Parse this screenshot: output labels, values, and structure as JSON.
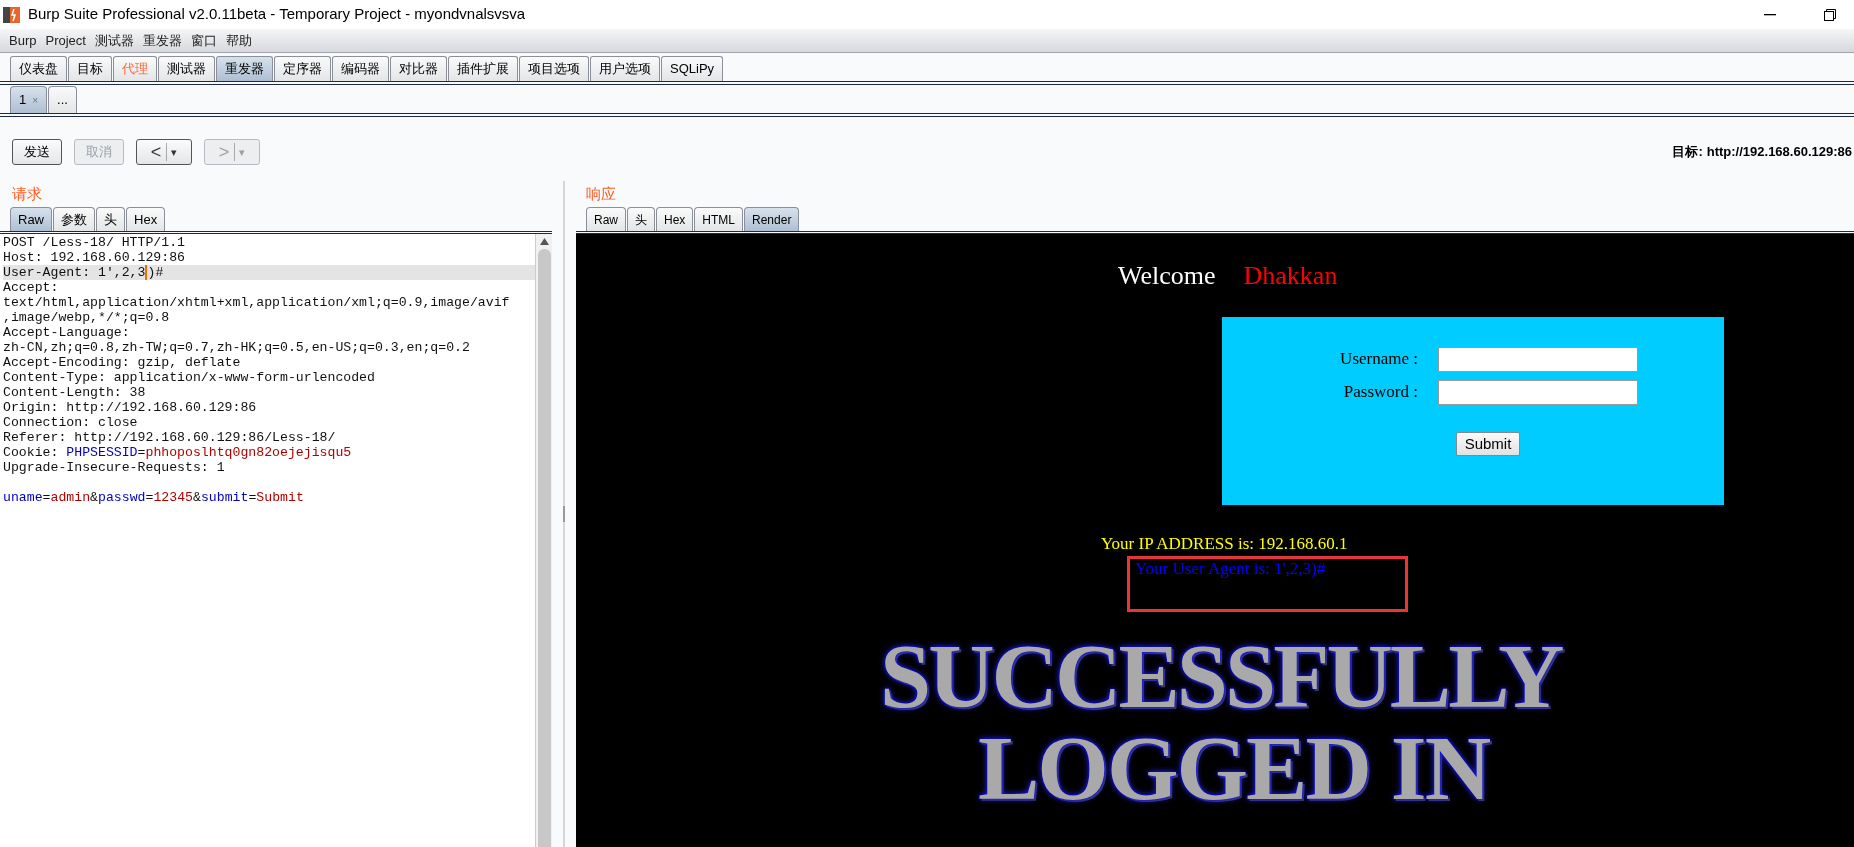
{
  "window": {
    "title": "Burp Suite Professional v2.0.11beta - Temporary Project - myondvnalsvsva"
  },
  "menu": [
    "Burp",
    "Project",
    "测试器",
    "重发器",
    "窗口",
    "帮助"
  ],
  "main_tabs": [
    {
      "label": "仪表盘",
      "selected": false,
      "highlighted": false
    },
    {
      "label": "目标",
      "selected": false,
      "highlighted": false
    },
    {
      "label": "代理",
      "selected": false,
      "highlighted": true
    },
    {
      "label": "测试器",
      "selected": false,
      "highlighted": false
    },
    {
      "label": "重发器",
      "selected": true,
      "highlighted": false
    },
    {
      "label": "定序器",
      "selected": false,
      "highlighted": false
    },
    {
      "label": "编码器",
      "selected": false,
      "highlighted": false
    },
    {
      "label": "对比器",
      "selected": false,
      "highlighted": false
    },
    {
      "label": "插件扩展",
      "selected": false,
      "highlighted": false
    },
    {
      "label": "项目选项",
      "selected": false,
      "highlighted": false
    },
    {
      "label": "用户选项",
      "selected": false,
      "highlighted": false
    },
    {
      "label": "SQLiPy",
      "selected": false,
      "highlighted": false
    }
  ],
  "repeater_tabs": [
    {
      "label": "1",
      "close": "×",
      "selected": true
    },
    {
      "label": "...",
      "selected": false
    }
  ],
  "toolbar": {
    "buttons": [
      {
        "kind": "text",
        "label": "发送",
        "disabled": false
      },
      {
        "kind": "text",
        "label": "取消",
        "disabled": true
      },
      {
        "kind": "nav",
        "label": "<",
        "caret": "▾",
        "disabled": false
      },
      {
        "kind": "nav",
        "label": ">",
        "caret": "▾",
        "disabled": true
      }
    ],
    "target_label": "目标:",
    "target_url": "http://192.168.60.129:86"
  },
  "request": {
    "title": "请求",
    "tabs": [
      {
        "label": "Raw",
        "selected": true
      },
      {
        "label": "参数",
        "selected": false
      },
      {
        "label": "头",
        "selected": false
      },
      {
        "label": "Hex",
        "selected": false
      }
    ],
    "lines": [
      {
        "kind": "text",
        "highlighted": false,
        "segments": [
          {
            "kind": "plain",
            "text": "POST /Less-18/ HTTP/1.1"
          }
        ]
      },
      {
        "kind": "text",
        "highlighted": false,
        "segments": [
          {
            "kind": "plain",
            "text": "Host: 192.168.60.129:86"
          }
        ]
      },
      {
        "kind": "text",
        "highlighted": true,
        "segments": [
          {
            "kind": "plain",
            "text": "User-Agent: 1',2,3"
          },
          {
            "kind": "caret",
            "text": ")"
          },
          {
            "kind": "plain",
            "text": "#"
          }
        ]
      },
      {
        "kind": "text",
        "highlighted": false,
        "segments": [
          {
            "kind": "plain",
            "text": "Accept:"
          }
        ]
      },
      {
        "kind": "text",
        "highlighted": false,
        "segments": [
          {
            "kind": "plain",
            "text": "text/html,application/xhtml+xml,application/xml;q=0.9,image/avif"
          }
        ]
      },
      {
        "kind": "text",
        "highlighted": false,
        "segments": [
          {
            "kind": "plain",
            "text": ",image/webp,*/*;q=0.8"
          }
        ]
      },
      {
        "kind": "text",
        "highlighted": false,
        "segments": [
          {
            "kind": "plain",
            "text": "Accept-Language:"
          }
        ]
      },
      {
        "kind": "text",
        "highlighted": false,
        "segments": [
          {
            "kind": "plain",
            "text": "zh-CN,zh;q=0.8,zh-TW;q=0.7,zh-HK;q=0.5,en-US;q=0.3,en;q=0.2"
          }
        ]
      },
      {
        "kind": "text",
        "highlighted": false,
        "segments": [
          {
            "kind": "plain",
            "text": "Accept-Encoding: gzip, deflate"
          }
        ]
      },
      {
        "kind": "text",
        "highlighted": false,
        "segments": [
          {
            "kind": "plain",
            "text": "Content-Type: application/x-www-form-urlencoded"
          }
        ]
      },
      {
        "kind": "text",
        "highlighted": false,
        "segments": [
          {
            "kind": "plain",
            "text": "Content-Length: 38"
          }
        ]
      },
      {
        "kind": "text",
        "highlighted": false,
        "segments": [
          {
            "kind": "plain",
            "text": "Origin: http://192.168.60.129:86"
          }
        ]
      },
      {
        "kind": "text",
        "highlighted": false,
        "segments": [
          {
            "kind": "plain",
            "text": "Connection: close"
          }
        ]
      },
      {
        "kind": "text",
        "highlighted": false,
        "segments": [
          {
            "kind": "plain",
            "text": "Referer: http://192.168.60.129:86/Less-18/"
          }
        ]
      },
      {
        "kind": "text",
        "highlighted": false,
        "segments": [
          {
            "kind": "plain",
            "text": "Cookie: "
          },
          {
            "kind": "name",
            "text": "PHPSESSID"
          },
          {
            "kind": "plain",
            "text": "="
          },
          {
            "kind": "value",
            "text": "phhoposlhtq0gn82oejejisqu5"
          }
        ]
      },
      {
        "kind": "text",
        "highlighted": false,
        "segments": [
          {
            "kind": "plain",
            "text": "Upgrade-Insecure-Requests: 1"
          }
        ]
      },
      {
        "kind": "blank"
      },
      {
        "kind": "text",
        "highlighted": false,
        "segments": [
          {
            "kind": "name",
            "text": "uname"
          },
          {
            "kind": "plain",
            "text": "="
          },
          {
            "kind": "value",
            "text": "admin"
          },
          {
            "kind": "plain",
            "text": "&"
          },
          {
            "kind": "name",
            "text": "passwd"
          },
          {
            "kind": "plain",
            "text": "="
          },
          {
            "kind": "value",
            "text": "12345"
          },
          {
            "kind": "plain",
            "text": "&"
          },
          {
            "kind": "name",
            "text": "submit"
          },
          {
            "kind": "plain",
            "text": "="
          },
          {
            "kind": "value",
            "text": "Submit"
          }
        ]
      }
    ]
  },
  "response": {
    "title": "响应",
    "tabs": [
      {
        "label": "Raw",
        "selected": false
      },
      {
        "label": "头",
        "selected": false
      },
      {
        "label": "Hex",
        "selected": false
      },
      {
        "label": "HTML",
        "selected": false
      },
      {
        "label": "Render",
        "selected": true
      }
    ],
    "render": {
      "welcome": "Welcome",
      "name": "Dhakkan",
      "fields": [
        {
          "label": "Username :"
        },
        {
          "label": "Password :"
        }
      ],
      "submit": "Submit",
      "ip_text": "Your IP ADDRESS is: 192.168.60.1",
      "agent_text": "Your User Agent is: 1',2,3)#",
      "agent_boxed": true,
      "banner": [
        "SUCCESSFULLY",
        "LOGGED IN"
      ]
    }
  }
}
